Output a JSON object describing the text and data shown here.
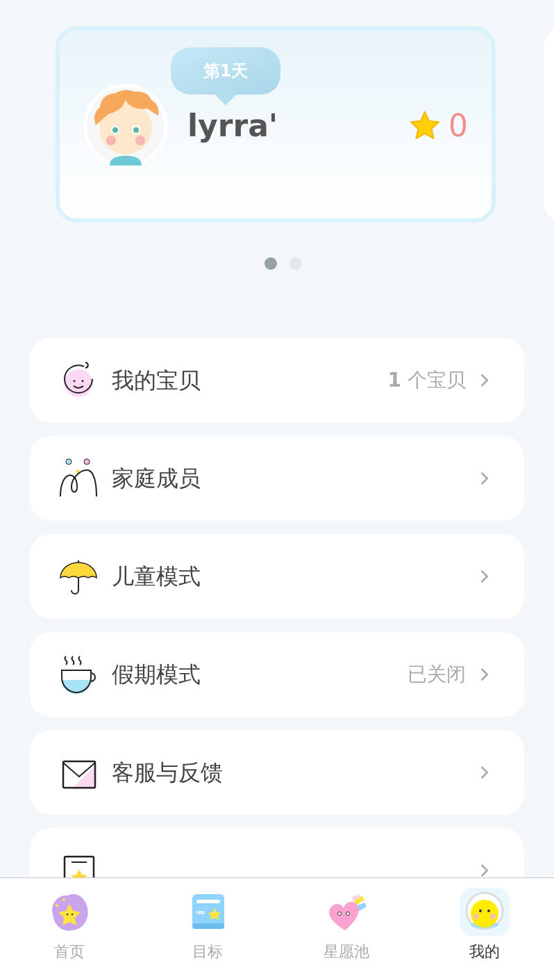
{
  "profile": {
    "badge": "第1天",
    "name": "lyrra'",
    "star_count": "0"
  },
  "carousel": {
    "dots": [
      {
        "selected": true
      },
      {
        "selected": false
      }
    ]
  },
  "menu": [
    {
      "label": "我的宝贝",
      "value": "**1** 个宝贝"
    },
    {
      "label": "家庭成员"
    },
    {
      "label": "儿童模式"
    },
    {
      "label": "假期模式",
      "value": "已关闭"
    },
    {
      "label": "客服与反馈"
    }
  ],
  "tabs": [
    {
      "label": "首页",
      "selected": false
    },
    {
      "label": "目标",
      "selected": false
    },
    {
      "label": "星愿池",
      "selected": false
    },
    {
      "label": "我的",
      "selected": true
    }
  ]
}
